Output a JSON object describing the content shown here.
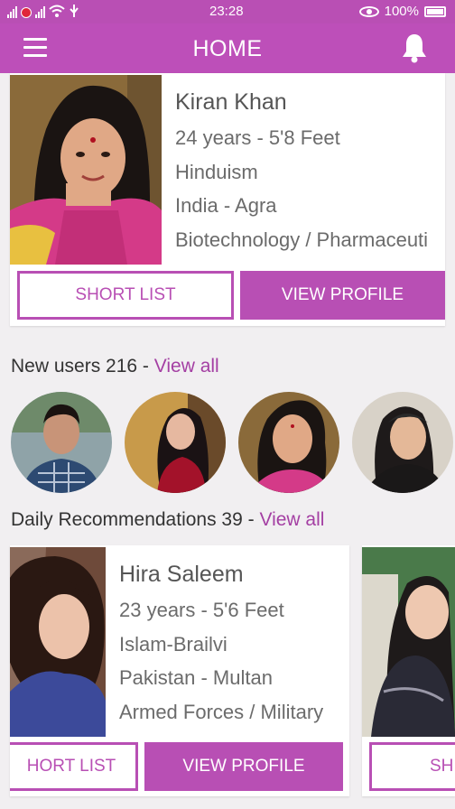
{
  "status_bar": {
    "time": "23:28",
    "battery": "100%"
  },
  "app_bar": {
    "title": "HOME"
  },
  "profile_card": {
    "name": "Kiran Khan",
    "details": [
      "24 years - 5'8 Feet",
      "Hinduism",
      "India - Agra",
      "Biotechnology / Pharmaceuti"
    ],
    "short_list_label": "SHORT LIST",
    "view_profile_label": "VIEW PROFILE"
  },
  "new_users": {
    "prefix": "New users 216 - ",
    "link": "View all"
  },
  "daily_recommendations": {
    "prefix": "Daily Recommendations 39 - ",
    "link": "View all",
    "card": {
      "name": "Hira Saleem",
      "details": [
        "23 years - 5'6 Feet",
        "Islam-Brailvi",
        "Pakistan - Multan",
        "Armed Forces / Military"
      ],
      "short_list_label": "HORT LIST",
      "view_profile_label": "VIEW PROFILE"
    },
    "next_card_button_label": "SH"
  },
  "colors": {
    "primary": "#bd4fb9",
    "accent_text": "#a43fa3",
    "background": "#f1eff1"
  }
}
